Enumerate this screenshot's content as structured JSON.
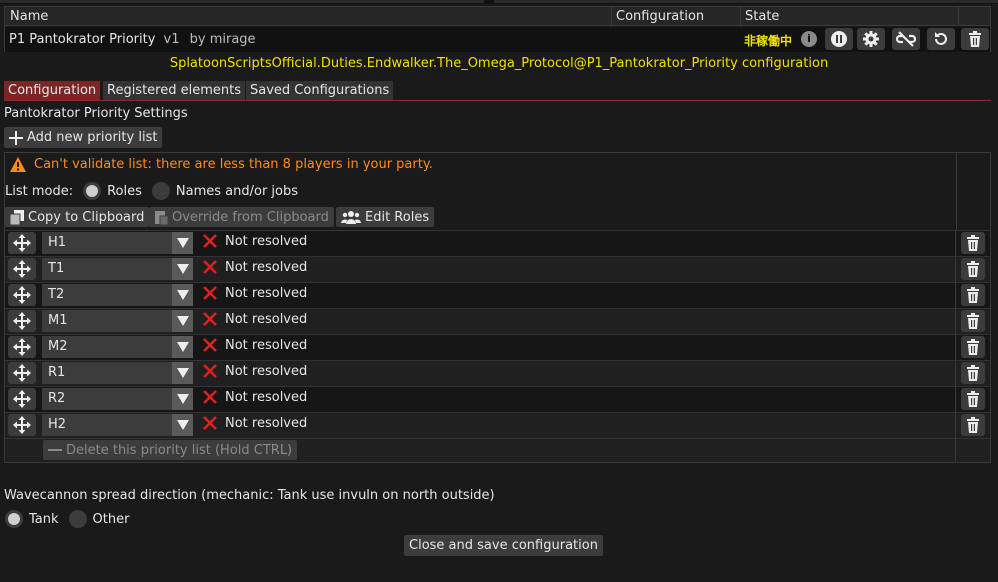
{
  "script_table": {
    "headers": [
      "Name",
      "Configuration",
      "State"
    ],
    "name": "P1 Pantokrator Priority",
    "version": "v1",
    "author": "by mirage",
    "state": "非稼働中",
    "info_glyph": "i",
    "icons": [
      "info-icon",
      "pause-icon",
      "gear-icon",
      "unlink-icon",
      "reload-icon",
      "trash-icon"
    ]
  },
  "config_title": "SplatoonScriptsOfficial.Duties.Endwalker.The_Omega_Protocol@P1_Pantokrator_Priority configuration",
  "tabs": [
    {
      "label": "Configuration",
      "active": true
    },
    {
      "label": "Registered elements",
      "active": false
    },
    {
      "label": "Saved Configurations",
      "active": false
    }
  ],
  "section_title": "Pantokrator Priority Settings",
  "add_button": "Add new priority list",
  "warning": "Can't validate list: there are less than 8 players in your party.",
  "list_mode": {
    "label": "List mode:",
    "options": [
      "Roles",
      "Names and/or jobs"
    ],
    "selected": "Roles"
  },
  "actions": {
    "copy": "Copy to Clipboard",
    "override": "Override from Clipboard",
    "edit_roles": "Edit Roles"
  },
  "priority_rows": [
    {
      "role": "H1",
      "status": "Not resolved"
    },
    {
      "role": "T1",
      "status": "Not resolved"
    },
    {
      "role": "T2",
      "status": "Not resolved"
    },
    {
      "role": "M1",
      "status": "Not resolved"
    },
    {
      "role": "M2",
      "status": "Not resolved"
    },
    {
      "role": "R1",
      "status": "Not resolved"
    },
    {
      "role": "R2",
      "status": "Not resolved"
    },
    {
      "role": "H2",
      "status": "Not resolved"
    }
  ],
  "delete_list": "Delete this priority list (Hold CTRL)",
  "wavecannon": {
    "label": "Wavecannon spread direction (mechanic: Tank use invuln on north outside)",
    "options": [
      "Tank",
      "Other"
    ],
    "selected": "Tank"
  },
  "close_button": "Close and save configuration",
  "colors": {
    "accent_yellow": "#f0e000",
    "warning_orange": "#ff8c1a",
    "active_tab": "#7a2626",
    "error_red": "#e02020"
  }
}
